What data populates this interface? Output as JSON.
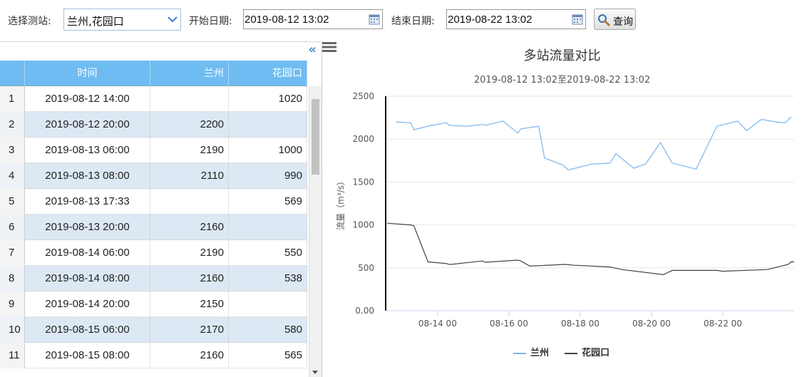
{
  "toolbar": {
    "station_label": "选择测站:",
    "station_value": "兰州,花园口",
    "start_label": "开始日期:",
    "start_value": "2019-08-12 13:02",
    "end_label": "结束日期:",
    "end_value": "2019-08-22 13:02",
    "query_label": "查询"
  },
  "panel": {
    "collapse_glyph": "«"
  },
  "table": {
    "columns": [
      "时间",
      "兰州",
      "花园口"
    ],
    "rows": [
      {
        "n": "1",
        "time": "2019-08-12 14:00",
        "lz": "",
        "hyk": "1020"
      },
      {
        "n": "2",
        "time": "2019-08-12 20:00",
        "lz": "2200",
        "hyk": ""
      },
      {
        "n": "3",
        "time": "2019-08-13 06:00",
        "lz": "2190",
        "hyk": "1000"
      },
      {
        "n": "4",
        "time": "2019-08-13 08:00",
        "lz": "2110",
        "hyk": "990"
      },
      {
        "n": "5",
        "time": "2019-08-13 17:33",
        "lz": "",
        "hyk": "569"
      },
      {
        "n": "6",
        "time": "2019-08-13 20:00",
        "lz": "2160",
        "hyk": ""
      },
      {
        "n": "7",
        "time": "2019-08-14 06:00",
        "lz": "2190",
        "hyk": "550"
      },
      {
        "n": "8",
        "time": "2019-08-14 08:00",
        "lz": "2160",
        "hyk": "538"
      },
      {
        "n": "9",
        "time": "2019-08-14 20:00",
        "lz": "2150",
        "hyk": ""
      },
      {
        "n": "10",
        "time": "2019-08-15 06:00",
        "lz": "2170",
        "hyk": "580"
      },
      {
        "n": "11",
        "time": "2019-08-15 08:00",
        "lz": "2160",
        "hyk": "565"
      }
    ]
  },
  "chart_data": {
    "type": "line",
    "title": "多站流量对比",
    "subtitle": "2019-08-12 13:02至2019-08-22 13:02",
    "ylabel": "流量（m³/s）",
    "ylim": [
      0,
      2500
    ],
    "yticks": [
      "0.00",
      "500",
      "1000",
      "1500",
      "2000",
      "2500"
    ],
    "xlim": [
      "2019-08-12 13:02",
      "2019-08-22 13:02"
    ],
    "xticks": [
      {
        "t": "2019-08-14 00:00",
        "label": "08-14 00"
      },
      {
        "t": "2019-08-16 00:00",
        "label": "08-16 00"
      },
      {
        "t": "2019-08-18 00:00",
        "label": "08-18 00"
      },
      {
        "t": "2019-08-20 00:00",
        "label": "08-20 00"
      },
      {
        "t": "2019-08-22 00:00",
        "label": "08-22 00"
      }
    ],
    "grid": true,
    "legend": "bottom",
    "series": [
      {
        "name": "兰州",
        "color": "#7cb5ec",
        "points": [
          [
            "2019-08-12 20:00",
            2200
          ],
          [
            "2019-08-13 06:00",
            2190
          ],
          [
            "2019-08-13 08:00",
            2110
          ],
          [
            "2019-08-13 20:00",
            2160
          ],
          [
            "2019-08-14 06:00",
            2190
          ],
          [
            "2019-08-14 08:00",
            2160
          ],
          [
            "2019-08-14 20:00",
            2150
          ],
          [
            "2019-08-15 06:00",
            2170
          ],
          [
            "2019-08-15 08:00",
            2160
          ],
          [
            "2019-08-15 20:00",
            2210
          ],
          [
            "2019-08-16 06:00",
            2070
          ],
          [
            "2019-08-16 08:00",
            2120
          ],
          [
            "2019-08-16 20:00",
            2150
          ],
          [
            "2019-08-17 00:00",
            1780
          ],
          [
            "2019-08-17 12:00",
            1700
          ],
          [
            "2019-08-17 16:00",
            1640
          ],
          [
            "2019-08-18 08:00",
            1710
          ],
          [
            "2019-08-18 20:00",
            1720
          ],
          [
            "2019-08-19 00:00",
            1830
          ],
          [
            "2019-08-19 12:00",
            1660
          ],
          [
            "2019-08-19 20:00",
            1710
          ],
          [
            "2019-08-20 06:00",
            1960
          ],
          [
            "2019-08-20 14:00",
            1720
          ],
          [
            "2019-08-21 06:00",
            1650
          ],
          [
            "2019-08-21 20:00",
            2150
          ],
          [
            "2019-08-22 10:00",
            2210
          ],
          [
            "2019-08-22 16:00",
            2100
          ],
          [
            "2019-08-23 02:00",
            2230
          ],
          [
            "2019-08-23 12:00",
            2200
          ],
          [
            "2019-08-23 18:00",
            2190
          ],
          [
            "2019-08-23 22:00",
            2260
          ]
        ]
      },
      {
        "name": "花园口",
        "color": "#434348",
        "points": [
          [
            "2019-08-12 14:00",
            1020
          ],
          [
            "2019-08-13 06:00",
            1000
          ],
          [
            "2019-08-13 08:00",
            990
          ],
          [
            "2019-08-13 17:33",
            569
          ],
          [
            "2019-08-14 06:00",
            550
          ],
          [
            "2019-08-14 08:00",
            538
          ],
          [
            "2019-08-15 06:00",
            580
          ],
          [
            "2019-08-15 08:00",
            565
          ],
          [
            "2019-08-16 06:00",
            590
          ],
          [
            "2019-08-16 08:00",
            580
          ],
          [
            "2019-08-16 14:00",
            520
          ],
          [
            "2019-08-17 14:00",
            540
          ],
          [
            "2019-08-17 20:00",
            530
          ],
          [
            "2019-08-18 20:00",
            510
          ],
          [
            "2019-08-19 04:00",
            480
          ],
          [
            "2019-08-20 08:00",
            420
          ],
          [
            "2019-08-20 14:00",
            470
          ],
          [
            "2019-08-21 20:00",
            470
          ],
          [
            "2019-08-22 00:00",
            460
          ],
          [
            "2019-08-23 06:00",
            480
          ],
          [
            "2019-08-23 20:00",
            540
          ],
          [
            "2019-08-23 22:00",
            570
          ],
          [
            "2019-08-24 00:00",
            570
          ]
        ]
      }
    ]
  }
}
